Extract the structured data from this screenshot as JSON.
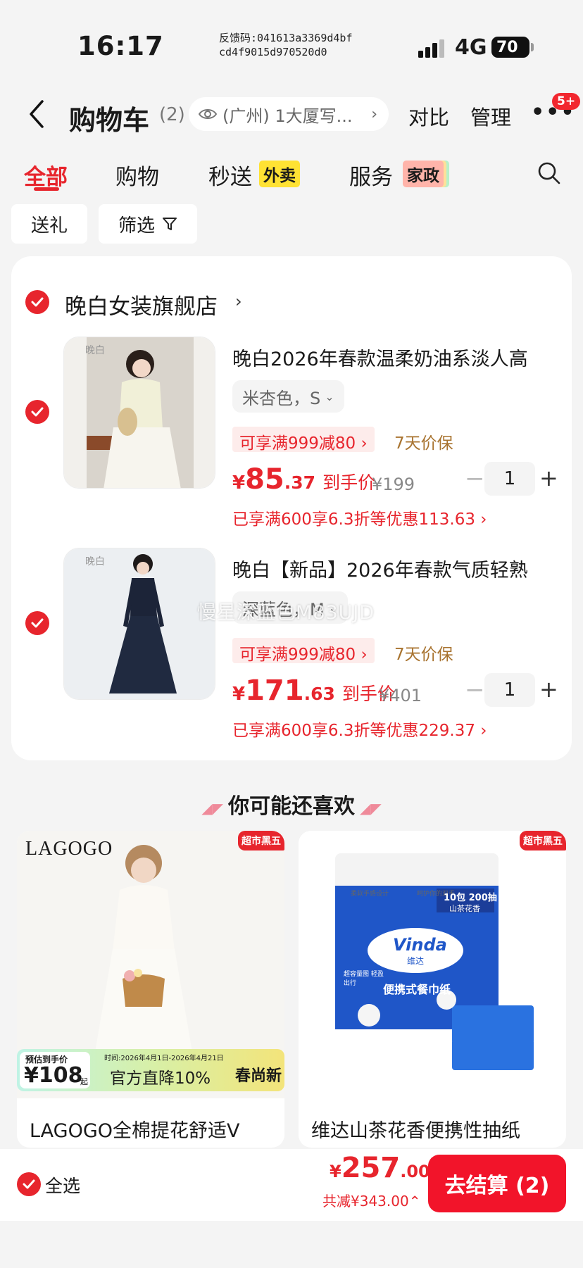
{
  "status": {
    "time": "16:17",
    "feedback_line1": "反馈码:041613a3369d4bf",
    "feedback_line2": "cd4f9015d970520d0",
    "network": "4G",
    "battery": "70"
  },
  "nav": {
    "title": "购物车",
    "count": "(2)",
    "location": "(广州) 1大厦写...",
    "compare": "对比",
    "manage": "管理",
    "more_badge": "5+"
  },
  "tabs": [
    {
      "label": "全部"
    },
    {
      "label": "购物"
    },
    {
      "label": "秒送",
      "tag": "外卖"
    },
    {
      "label": "服务",
      "tag": "家政"
    }
  ],
  "filters": {
    "gift": "送礼",
    "filter": "筛选"
  },
  "shop": {
    "name": "晚白女装旗舰店"
  },
  "items": [
    {
      "name": "晚白2026年春款温柔奶油系淡人高",
      "spec": "米杏色，S",
      "promo": "可享满999减80",
      "guarantee": "7天价保",
      "price_symbol": "¥",
      "price_int": "85",
      "price_dec": ".37",
      "price_label": "到手价",
      "original": "¥199",
      "qty": "1",
      "discount": "已享满600享6.3折等优惠113.63",
      "thumb_logo": "晚白"
    },
    {
      "name": "晚白【新品】2026年春款气质轻熟",
      "spec": "深蓝色，M",
      "promo": "可享满999减80",
      "guarantee": "7天价保",
      "price_symbol": "¥",
      "price_int": "171",
      "price_dec": ".63",
      "price_label": "到手价",
      "original": "¥401",
      "qty": "1",
      "discount": "已享满600享6.3折等优惠229.37",
      "thumb_logo": "晚白"
    }
  ],
  "watermark": "慢星深蓝色M83UJD",
  "recommend": {
    "title": "你可能还喜欢",
    "cards": [
      {
        "brand": "LAGOGO",
        "hot_tag": "超市黑五",
        "est_label": "预估到手价",
        "est_price": "¥108",
        "est_suffix": "起",
        "promo_date": "时间:2026年4月1日-2026年4月21日",
        "promo_text": "官方直降10%",
        "promo_right": "春尚新",
        "name": "LAGOGO全棉提花舒适V"
      },
      {
        "hot_tag": "超市黑五",
        "pack_top_left": "柔软手感设计",
        "pack_top_right": "呵护你的双手",
        "pack_count": "10包 200抽",
        "pack_scent": "山茶花香",
        "pack_brand": "Vinda",
        "pack_brand_cn": "维达",
        "pack_product": "便携式餐巾纸",
        "pack_note": "超容量图 轻盈出行",
        "name": "维达山茶花香便携性抽纸"
      }
    ]
  },
  "bottom": {
    "select_all": "全选",
    "total_symbol": "¥",
    "total_int": "257",
    "total_dec": ".00",
    "reduce": "共减¥343.00",
    "checkout": "去结算 (2)"
  }
}
